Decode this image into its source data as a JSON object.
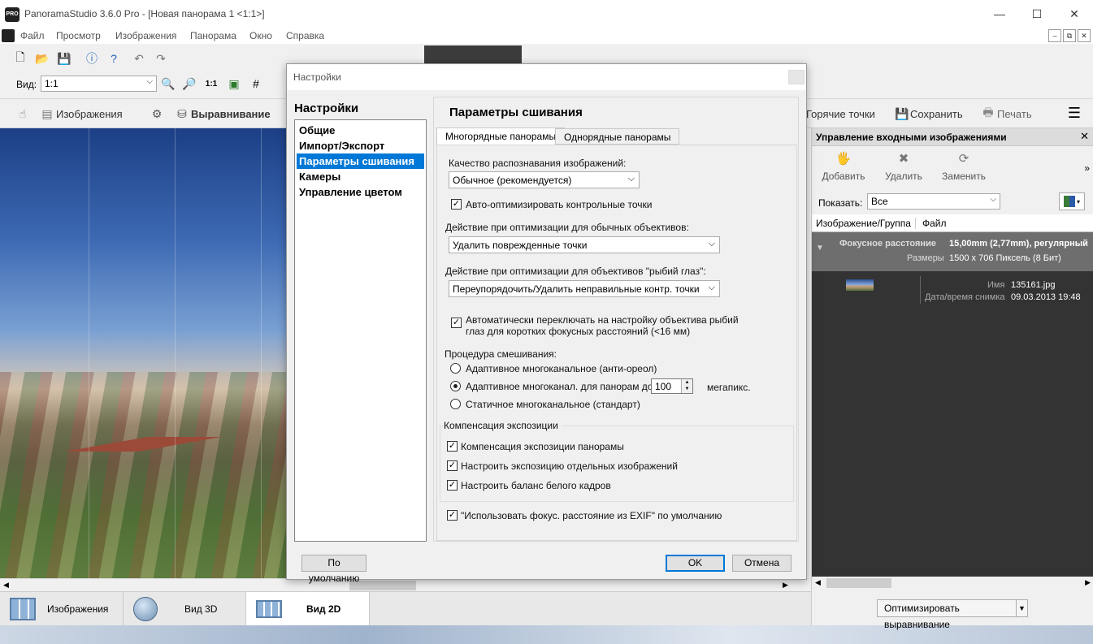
{
  "app": {
    "title": "PanoramaStudio 3.6.0 Pro - [Новая панорама 1 <1:1>]",
    "window_controls": {
      "minimize": "—",
      "maximize": "☐",
      "close": "✕"
    },
    "mdi_controls": {
      "minimize": "–",
      "restore": "⧉",
      "close": "✕"
    }
  },
  "menu": [
    "Файл",
    "Просмотр",
    "Изображения",
    "Панорама",
    "Окно",
    "Справка"
  ],
  "toolbar": {
    "view_label": "Вид:",
    "view_value": "1:1"
  },
  "toolbar2": {
    "images": "Изображения",
    "alignment": "Выравнивание",
    "hotspots": "Горячие точки",
    "save": "Сохранить",
    "print": "Печать"
  },
  "bottom_tabs": [
    {
      "label": "Изображения",
      "active": false
    },
    {
      "label": "Вид 3D",
      "active": false
    },
    {
      "label": "Вид 2D",
      "active": true
    }
  ],
  "right_panel": {
    "title": "Управление входными изображениями",
    "tools": [
      "Добавить",
      "Удалить",
      "Заменить"
    ],
    "show_label": "Показать:",
    "show_value": "Все",
    "columns": [
      "Изображение/Группа",
      "Файл"
    ],
    "group": {
      "focal_label": "Фокусное расстояние",
      "focal_value": "15,00mm (2,77mm), регулярный",
      "size_label": "Размеры",
      "size_value": "1500 x 706 Пиксель (8 Бит)"
    },
    "item": {
      "name_label": "Имя",
      "name_value": "135161.jpg",
      "date_label": "Дата/время снимка",
      "date_value": "09.03.2013 19:48"
    },
    "optimize_button": "Оптимизировать выравнивание"
  },
  "dialog": {
    "title": "Настройки",
    "left_title": "Настройки",
    "nav": [
      {
        "label": "Общие",
        "selected": false
      },
      {
        "label": "Импорт/Экспорт",
        "selected": false
      },
      {
        "label": "Параметры сшивания",
        "selected": true
      },
      {
        "label": "Камеры",
        "selected": false
      },
      {
        "label": "Управление цветом",
        "selected": false
      }
    ],
    "section_title": "Параметры сшивания",
    "tabs": [
      {
        "label": "Многорядные панорамы",
        "active": true
      },
      {
        "label": "Однорядные панорамы",
        "active": false
      }
    ],
    "quality_label": "Качество распознавания изображений:",
    "quality_value": "Обычное (рекомендуется)",
    "auto_optimize": "Авто-оптимизировать контрольные точки",
    "normal_lens_label": "Действие при оптимизации для обычных объективов:",
    "normal_lens_value": "Удалить поврежденные точки",
    "fisheye_label": "Действие при оптимизации для объективов \"рыбий глаз\":",
    "fisheye_value": "Переупорядочить/Удалить неправильные контр. точки",
    "auto_fisheye_line1": "Автоматически переключать на настройку объектива рыбий",
    "auto_fisheye_line2": "глаз для коротких фокусных расстояний (<16 мм)",
    "blend_label": "Процедура смешивания:",
    "blend_options": [
      "Адаптивное многоканальное (анти-ореол)",
      "Адаптивное многоканал. для панорам до",
      "Статичное многоканальное (стандарт)"
    ],
    "blend_selected": 1,
    "megapix_value": "100",
    "megapix_unit": "мегапикс.",
    "exposure_group": "Компенсация экспозиции",
    "exposure_items": [
      "Компенсация экспозиции панорамы",
      "Настроить экспозицию отдельных изображений",
      "Настроить баланс белого кадров"
    ],
    "exif_option": "\"Использовать фокус. расстояние из EXIF\" по умолчанию",
    "buttons": {
      "default": "По умолчанию",
      "ok": "OK",
      "cancel": "Отмена"
    }
  }
}
